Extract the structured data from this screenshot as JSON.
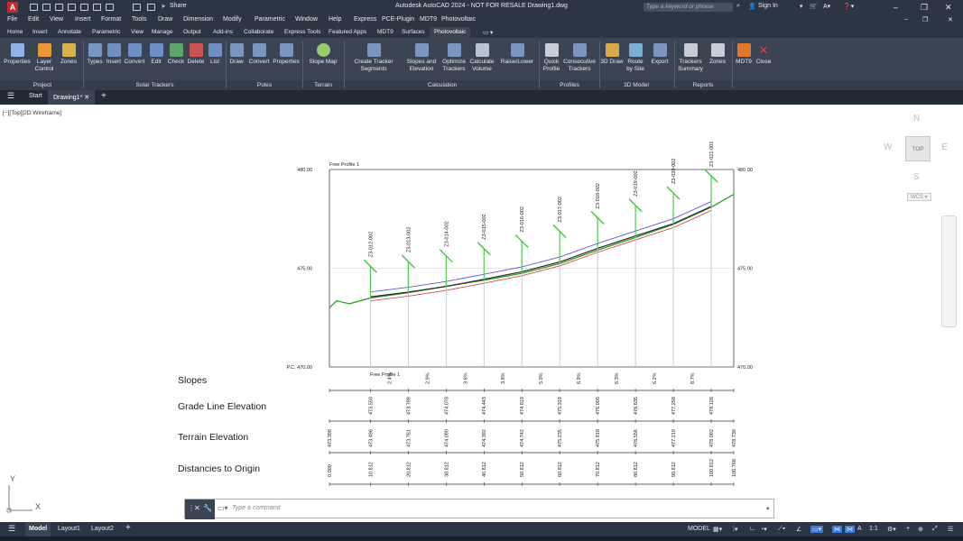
{
  "titlebar": {
    "app_icon": "A",
    "share_label": "Share",
    "window_title": "Autodesk AutoCAD 2024 - NOT FOR RESALE   Drawing1.dwg",
    "search_placeholder": "Type a keyword or phrase",
    "sign_in_label": "Sign In",
    "minimize_glyph": "–",
    "restore_glyph": "❐",
    "close_glyph": "✕"
  },
  "menubar": {
    "items": [
      "File",
      "Edit",
      "View",
      "Insert",
      "Format",
      "Tools",
      "Draw",
      "Dimension",
      "Modify",
      "Parametric",
      "Window",
      "Help",
      "Express",
      "PCE-Plugin",
      "MDT9",
      "Photovoltaic"
    ],
    "doc_minimize_glyph": "–",
    "doc_restore_glyph": "❐",
    "doc_close_glyph": "✕"
  },
  "ribbon_tabs": {
    "items": [
      "Home",
      "Insert",
      "Annotate",
      "Parametric",
      "View",
      "Manage",
      "Output",
      "Add-ins",
      "Collaborate",
      "Express Tools",
      "Featured Apps",
      "MDT9",
      "Surfaces",
      "Photovoltaic"
    ],
    "active": "Photovoltaic",
    "options_glyph": "▭ ▾"
  },
  "ribbon_panels": [
    {
      "name": "Project",
      "tools": [
        "Properties",
        "Layer Control",
        "Zones"
      ]
    },
    {
      "name": "Solar Trackers",
      "tools": [
        "Types",
        "Insert",
        "Convert",
        "Edit",
        "Check",
        "Delete",
        "List"
      ]
    },
    {
      "name": "Poles",
      "tools": [
        "Draw",
        "Convert",
        "Properties"
      ]
    },
    {
      "name": "Terrain",
      "tools": [
        "Slope Map"
      ]
    },
    {
      "name": "Calculation",
      "tools": [
        "Create Tracker Segments",
        "Slopes and Elevation",
        "Optimize Trackers",
        "Calculate Volume",
        "Raise/Lower"
      ]
    },
    {
      "name": "Profiles",
      "tools": [
        "Quick Profile",
        "Consecutive Trackers"
      ]
    },
    {
      "name": "3D Model",
      "tools": [
        "3D Draw",
        "Route by Site",
        "Export"
      ]
    },
    {
      "name": "Reports",
      "tools": [
        "Trackers Summary",
        "Zones"
      ]
    },
    {
      "name": "",
      "tools": [
        "MDT9",
        "Close"
      ]
    }
  ],
  "doc_tabs": {
    "menu_glyph": "☰",
    "start": "Start",
    "drawing": "Drawing1*",
    "close_glyph": "✕",
    "add_glyph": "+"
  },
  "viewport": {
    "label": "[−][Top][2D Wireframe]",
    "viewcube": {
      "face": "TOP",
      "n": "N",
      "s": "S",
      "e": "E",
      "w": "W",
      "wcs": "WCS ▾"
    },
    "ucs": {
      "x": "X",
      "y": "Y"
    }
  },
  "profile": {
    "title": "Free Profile 1",
    "baseline_title": "Free Profile 1",
    "left_elev_labels": [
      "480.00",
      "475.00",
      "P.C. 470.00"
    ],
    "right_elev_labels": [
      "480.00",
      "475.00",
      "470.00"
    ],
    "trackers": [
      "Z3-012-002",
      "Z3-013-002",
      "Z3-014-002",
      "Z3-015-002",
      "Z3-016-002",
      "Z3-017-002",
      "Z3-018-002",
      "Z3-019-002",
      "Z3-020-002",
      "Z3-021-001"
    ],
    "slopes": [
      "2.4%",
      "2.9%",
      "3.6%",
      "3.8%",
      "5.0%",
      "6.9%",
      "6.3%",
      "6.2%",
      "8.7%"
    ],
    "grade_line_elevation": [
      "473.550",
      "473.789",
      "474.078",
      "474.443",
      "474.819",
      "475.319",
      "476.005",
      "476.635",
      "477.258",
      "478.126"
    ],
    "terrain_elevation": [
      "473.398",
      "473.496",
      "473.761",
      "474.090",
      "474.392",
      "474.742",
      "475.235",
      "475.918",
      "476.556",
      "477.219",
      "478.092",
      "478.739"
    ],
    "distances_to_origin": [
      "0.000",
      "10.812",
      "20.812",
      "30.812",
      "40.812",
      "50.812",
      "60.812",
      "70.812",
      "80.812",
      "90.812",
      "100.812",
      "106.768"
    ],
    "row_labels": {
      "slopes": "Slopes",
      "grade": "Grade Line Elevation",
      "terrain": "Terrain Elevation",
      "distances": "Distancies to Origin"
    },
    "colors": {
      "frame": "#404040",
      "terrain": "#2e9e2e",
      "grade": "#2b2b2b",
      "upper": "#5b5bd6",
      "lower": "#d94a4a",
      "tracker": "#43c43a",
      "grid": "#cccccc"
    }
  },
  "command_line": {
    "placeholder": "Type a command",
    "close_glyph": "✕",
    "wrench_glyph": "🔧",
    "expand_glyph": "▴"
  },
  "statusbar": {
    "menu_glyph": "☰",
    "tabs": [
      "Model",
      "Layout1",
      "Layout2"
    ],
    "add_glyph": "+",
    "model_label": "MODEL",
    "scale": "1:1",
    "icons": [
      "grid-icon",
      "snap-icon",
      "ortho-icon",
      "polar-icon",
      "isodraft-icon",
      "osnap-icon",
      "annotation-icon",
      "workspace-icon",
      "customize-icon"
    ]
  }
}
